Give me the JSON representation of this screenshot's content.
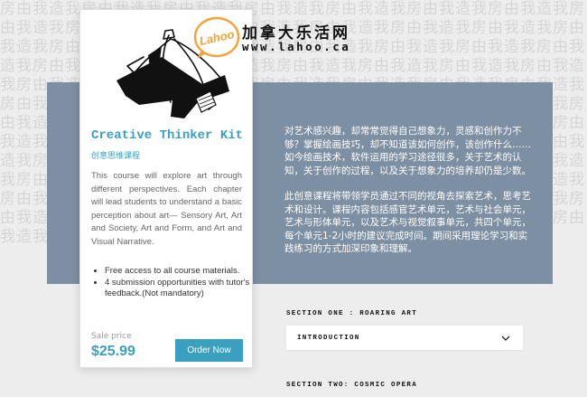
{
  "background": {
    "pattern_text": "房由我造我房由我造我房由我造我房由我造我房由我造我房由我造我房由我造我房由我造我房由我造我房由我造我房由我造我房由我造我房由我造我房由我造我房由我造我房由我造我房由我造我房由我造我房由我造我房由我造我房由我造我房由我造我房由我造我房由我造我房由我造我房由我造我房由我造我房由我造我房由我造我房由我造我房由我造我房由我造我房由我造我房由我造我房由我造我房由我造我房由我造我房由我造我房由我造我房由我造我房由我造我房由我造我房由我造我房由我造我房由我造我房由我造我房由我造我房由我造我房由我造我房由我造我房由我造我房由我造我房由我造我房由我造我房由我造我房由我造我房由我造我房由我造我房由我造我房由我造我房由我造我房由我造我房由我造我房由我造我房由我造我房由我造我房由我造我房由我造我房由我造我房由我造我房由我造我房由我造我房由我造我房由我造我房由我造我房由我造我房由我造我房由我造我房由我造我房由我造我房由我造我房由我造我房由我造我房由我造我房由我造我房由我造我房由我造我房由我造我房由我造我房由我造我房由我造我房由我造我"
  },
  "brand": {
    "logo_text": "Lahoo",
    "name_cn": "加拿大乐活网",
    "url": "www.lahoo.ca",
    "accent": "#f2a33a"
  },
  "card": {
    "title": "Creative Thinker Kit",
    "subtitle": "创意思维课程",
    "description": "This course will explore art through different perspectives. Each chapter will lead students to understand a basic perception about art— Sensory Art, Art and Society, Art and Form, and Art and Visual Narrative.",
    "bullets": [
      "Free access to all course materials.",
      "4 submission opportunities with tutor's feedback.(Not mandatory)"
    ],
    "sale_label": "Sale price",
    "price": "$25.99",
    "order_button": "Order Now",
    "accent": "#3aa0c0"
  },
  "info": {
    "paragraph1": "对艺术感兴趣，却常常觉得自己想象力，灵感和创作力不够？掌握绘画技巧，却不知道该如何创作，该创作什么……如今绘画技术，软件运用的学习途径很多，关于艺术的认知，关于创作的过程，以及关于想象力的培养却仍是少数。",
    "paragraph2": "此创意课程将带领学员通过不同的视角去探索艺术，思考艺术和设计。课程内容包括感官艺术单元，艺术与社会单元，艺术与形体单元，以及艺术与视觉叙事单元，共四个单元，每个单元1-2小时的建议完成时间。期间采用理论学习和实践练习的方式加深印象和理解。",
    "panel_color": "#7d8fa2"
  },
  "sections": {
    "section1_label": "SECTION ONE : ROARING ART",
    "accordion_label": "INTRODUCTION",
    "section2_label": "SECTION TWO: COSMIC OPERA"
  }
}
